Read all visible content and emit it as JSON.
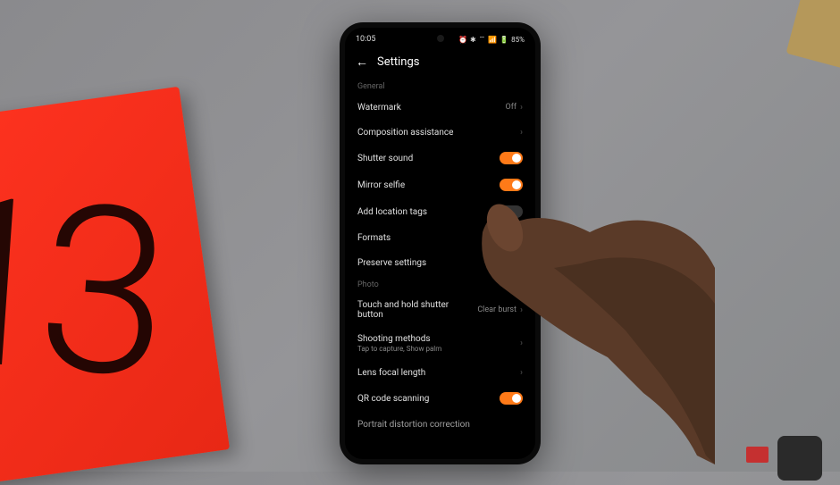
{
  "statusBar": {
    "time": "10:05",
    "battery": "85%",
    "icons": "⏰ ✱ ⌔ 📶 📶 🔋"
  },
  "header": {
    "title": "Settings"
  },
  "sections": {
    "general": {
      "label": "General",
      "watermark": {
        "label": "Watermark",
        "value": "Off"
      },
      "compositionAssistance": {
        "label": "Composition assistance"
      },
      "shutterSound": {
        "label": "Shutter sound",
        "state": "on"
      },
      "mirrorSelfie": {
        "label": "Mirror selfie",
        "state": "on"
      },
      "addLocationTags": {
        "label": "Add location tags",
        "state": "off"
      },
      "formats": {
        "label": "Formats"
      },
      "preserveSettings": {
        "label": "Preserve settings"
      }
    },
    "photo": {
      "label": "Photo",
      "touchHold": {
        "label": "Touch and hold shutter button",
        "value": "Clear burst"
      },
      "shootingMethods": {
        "label": "Shooting methods",
        "sublabel": "Tap to capture, Show palm"
      },
      "lensFocal": {
        "label": "Lens focal length"
      },
      "qrScanning": {
        "label": "QR code scanning",
        "state": "on"
      },
      "portraitDistortion": {
        "label": "Portrait distortion correction"
      }
    }
  }
}
